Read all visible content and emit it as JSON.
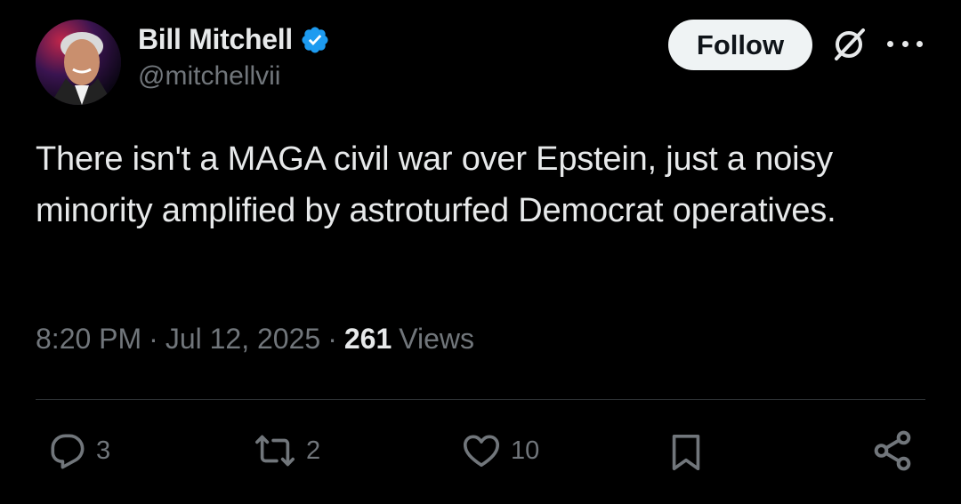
{
  "author": {
    "name": "Bill Mitchell",
    "handle": "@mitchellvii",
    "verified": true,
    "verified_color": "#1d9bf0"
  },
  "header": {
    "follow_label": "Follow",
    "grok_icon": "grok-icon",
    "more_icon": "more-dots-icon"
  },
  "tweet": {
    "text": "There isn't a MAGA civil war over Epstein, just a noisy minority amplified by astroturfed Democrat operatives.",
    "time": "8:20 PM",
    "date": "Jul 12, 2025",
    "views_count": "261",
    "views_label": "Views"
  },
  "actions": {
    "replies": "3",
    "reposts": "2",
    "likes": "10"
  },
  "colors": {
    "background": "#000000",
    "text": "#e7e9ea",
    "muted": "#71767b",
    "divider": "#2f3336"
  }
}
